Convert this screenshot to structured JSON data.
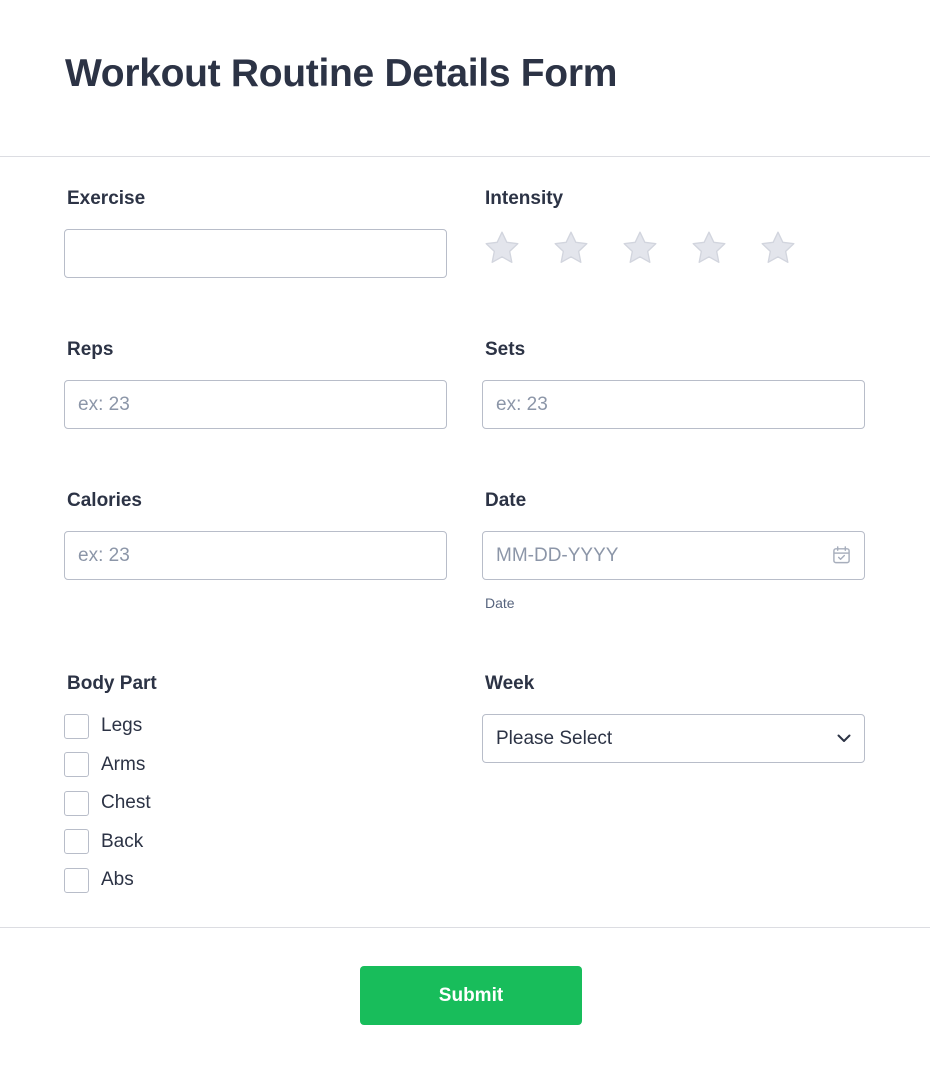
{
  "form": {
    "title": "Workout Routine Details Form"
  },
  "fields": {
    "exercise": {
      "label": "Exercise",
      "value": "",
      "placeholder": ""
    },
    "intensity": {
      "label": "Intensity",
      "rating": 0,
      "max": 5
    },
    "reps": {
      "label": "Reps",
      "value": "",
      "placeholder": "ex: 23"
    },
    "sets": {
      "label": "Sets",
      "value": "",
      "placeholder": "ex: 23"
    },
    "calories": {
      "label": "Calories",
      "value": "",
      "placeholder": "ex: 23"
    },
    "date": {
      "label": "Date",
      "value": "",
      "placeholder": "MM-DD-YYYY",
      "sublabel": "Date",
      "icon": "calendar-icon"
    },
    "body_part": {
      "label": "Body Part",
      "options": [
        {
          "label": "Legs",
          "checked": false
        },
        {
          "label": "Arms",
          "checked": false
        },
        {
          "label": "Chest",
          "checked": false
        },
        {
          "label": "Back",
          "checked": false
        },
        {
          "label": "Abs",
          "checked": false
        }
      ]
    },
    "week": {
      "label": "Week",
      "selected": "Please Select",
      "icon": "chevron-down-icon"
    }
  },
  "actions": {
    "submit_label": "Submit"
  },
  "colors": {
    "submit_bg": "#18bd5b",
    "star_fill": "#e3e5ec",
    "border": "#b8bdc9",
    "text": "#2c3345"
  }
}
